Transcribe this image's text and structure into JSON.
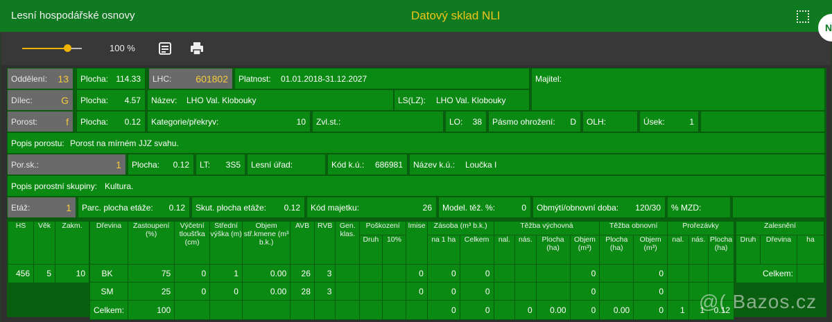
{
  "topbar": {
    "app_title": "Lesní hospodářské osnovy",
    "system_title": "Datový sklad NLI",
    "avatar_letter": "N"
  },
  "toolbar": {
    "zoom_label": "100 %",
    "zoom_percent": 100
  },
  "header": {
    "oddeleni": {
      "label": "Oddělení:",
      "value": "13"
    },
    "plocha1": {
      "label": "Plocha:",
      "value": "114.33"
    },
    "lhc": {
      "label": "LHC:",
      "value": "601802"
    },
    "platnost": {
      "label": "Platnost:",
      "value": "01.01.2018-31.12.2027"
    },
    "majitel": {
      "label": "Majitel:"
    },
    "dilec": {
      "label": "Dílec:",
      "value": "G"
    },
    "plocha2": {
      "label": "Plocha:",
      "value": "4.57"
    },
    "nazev": {
      "label": "Název:",
      "value": "LHO Val. Klobouky"
    },
    "lslz": {
      "label": "LS(LZ):",
      "value": "LHO Val. Klobouky"
    },
    "porost": {
      "label": "Porost:",
      "value": "f"
    },
    "plocha3": {
      "label": "Plocha:",
      "value": "0.12"
    },
    "kategorie": {
      "label": "Kategorie/překryv:",
      "value": "10"
    },
    "zvlst": {
      "label": "Zvl.st.:"
    },
    "lo": {
      "label": "LO:",
      "value": "38"
    },
    "pasmo": {
      "label": "Pásmo ohrožení:",
      "value": "D"
    },
    "olh": {
      "label": "OLH:"
    },
    "usek": {
      "label": "Úsek:",
      "value": "1"
    },
    "popis_porostu": {
      "label": "Popis porostu:",
      "value": "Porost na mírném JJZ svahu."
    },
    "porsk": {
      "label": "Por.sk.:",
      "value": "1"
    },
    "plocha4": {
      "label": "Plocha:",
      "value": "0.12"
    },
    "lt": {
      "label": "LT:",
      "value": "3S5"
    },
    "lesni_urad": {
      "label": "Lesní úřad:"
    },
    "kod_ku": {
      "label": "Kód k.ú.:",
      "value": "686981"
    },
    "nazev_ku": {
      "label": "Název k.ú.:",
      "value": "Loučka I"
    },
    "popis_skupiny": {
      "label": "Popis porostní skupiny:",
      "value": "Kultura."
    },
    "etaz": {
      "label": "Etáž:",
      "value": "1"
    },
    "parc_plocha": {
      "label": "Parc. plocha etáže:",
      "value": "0.12"
    },
    "skut_plocha": {
      "label": "Skut. plocha etáže:",
      "value": "0.12"
    },
    "kod_majetku": {
      "label": "Kód majetku:",
      "value": "26"
    },
    "model_tez": {
      "label": "Model. těž. %:",
      "value": "0"
    },
    "obmyti": {
      "label": "Obmýtí/obnovní doba:",
      "value": "120/30"
    },
    "mzd": {
      "label": "% MZD:"
    }
  },
  "left_table": {
    "headers": [
      "HS",
      "Věk",
      "Zakm."
    ],
    "row": [
      "456",
      "5",
      "10"
    ]
  },
  "main_table": {
    "h_drevina": "Dřevina",
    "h_zastoupeni": "Zastoupení (%)",
    "h_vyctova": "Výčetní tloušťka (cm)",
    "h_stredni": "Střední výška (m)",
    "h_objem": "Objem stř.kmene (m³ b.k.)",
    "h_avb": "AVB",
    "h_rvb": "RVB",
    "h_gen": "Gen. klas.",
    "h_poskozeni": "Poškození",
    "h_druh": "Druh",
    "h_10": "10%",
    "h_imise": "Imise",
    "h_zasoba": "Zásoba (m³ b.k.)",
    "h_na1ha": "na 1 ha",
    "h_celkem": "Celkem",
    "h_tezba_vych": "Těžba výchovná",
    "h_nal": "nal.",
    "h_nas": "nás.",
    "h_plocha_ha": "Plocha (ha)",
    "h_objem_m3": "Objem (m³)",
    "h_tezba_obn": "Těžba obnovní",
    "h_prorezavky": "Prořezávky",
    "rows": [
      {
        "drevina": "BK",
        "zast": "75",
        "tl": "0",
        "vy": "1",
        "obj": "0.00",
        "avb": "26",
        "rvb": "3",
        "imise": "0",
        "na1ha": "0",
        "celk": "0",
        "tv_obj": "0",
        "to_obj": "0"
      },
      {
        "drevina": "SM",
        "zast": "25",
        "tl": "0",
        "vy": "0",
        "obj": "0.00",
        "avb": "28",
        "rvb": "3",
        "imise": "0",
        "na1ha": "0",
        "celk": "0",
        "tv_obj": "0",
        "to_obj": "0"
      }
    ],
    "total": {
      "label": "Celkem:",
      "zast": "100",
      "na1ha": "0",
      "celk": "0",
      "tv_nas": "0",
      "tv_plocha": "0.00",
      "tv_obj": "0",
      "to_plocha": "0.00",
      "to_obj": "0",
      "pr_nal": "1",
      "pr_nas": "1",
      "pr_plocha": "0.12"
    }
  },
  "zalesneni": {
    "title": "Zalesnění",
    "h_druh": "Druh",
    "h_drevina": "Dřevina",
    "h_ha": "ha",
    "total": "Celkem:"
  },
  "watermark": "@( Bazos.cz"
}
